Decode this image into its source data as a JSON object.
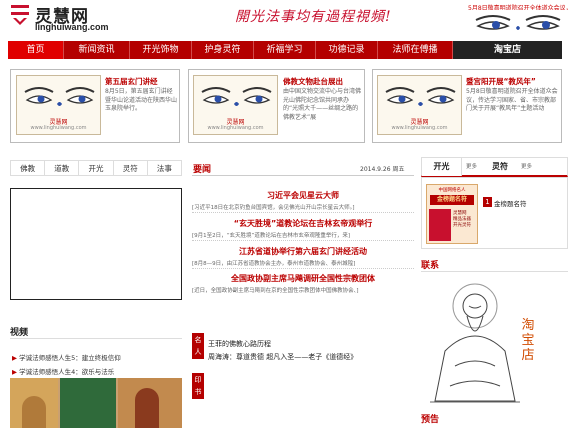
{
  "header": {
    "logo_cn": "灵慧网",
    "logo_en": "linghuiwang.com",
    "slogan": "開光法事均有過程視頻!",
    "banner_note": "5月8日敬喜明道院召开全体道众会议，传达学习国家、省、市宗教部门关于开展“教风年”"
  },
  "nav": [
    "首页",
    "新闻资讯",
    "开光饰物",
    "护身灵符",
    "祈福学习",
    "功德记录",
    "法师在傅播",
    "淘宝店"
  ],
  "promos": [
    {
      "title": "第五届玄门讲经",
      "desc": "8月5日，第五届玄门讲经暨华山论道活动在陕西华山玉泉院举行。",
      "img_caption": "灵慧网",
      "img_url": "www.linghuiwang.com"
    },
    {
      "title": "佛教文物赴台展出",
      "desc": "由中国文物交流中心与台湾佛光山佛陀纪念馆共同承办的“光照大千——丝绸之路的佛教艺术”展",
      "img_caption": "灵慧网",
      "img_url": "www.linghuiwang.com"
    },
    {
      "title": "暨宫阳开展“教风年”",
      "desc": "5月8日敬喜明道院召开全体道众会议，传达学习国家、省、市宗教部门关于开展“教风年”主题活动",
      "img_caption": "灵慧网",
      "img_url": "www.linghuiwang.com"
    }
  ],
  "left_tabs": [
    "佛教",
    "道教",
    "开光",
    "灵符",
    "法事"
  ],
  "video": {
    "title": "视频",
    "items": [
      "学诚法师感悟人生5：建立终极信仰",
      "学诚法师感悟人生4：欲乐与法乐"
    ]
  },
  "middle": {
    "section": "要闻",
    "date": "2014.9.26 周五",
    "news": [
      {
        "title": "习近平会见星云大师",
        "desc": "[习近平18日在北京钓鱼台国宾馆，会见佛光山开山宗长星云大师。]"
      },
      {
        "title": "“玄天胜境”道教论坛在吉林玄帝观举行",
        "desc": "[9月1至2日，“玄天胜境”道教论坛在吉林市玄帝观隆重举行，来]"
      },
      {
        "title": "江苏省道协举行第六届玄门讲经活动",
        "desc": "[8月8—9日，由江苏省道教协会主办，泰州市道教协会、泰州城隍]"
      },
      {
        "title": "全国政协副主席马飚调研全国性宗教团体",
        "desc": "[近日，全国政协副主席马飚到在京的全国性宗教团体中国佛教协会、]"
      }
    ],
    "tag1": "名人",
    "tag2": "印书",
    "famous_items": [
      "王菲的佛教心路历程",
      "周海涛：尊道贵德 超凡入圣——老子《道德经》"
    ]
  },
  "right": {
    "tab_active": "开光",
    "tab_other": "灵符",
    "more_label": "更多",
    "rank_no": "1",
    "rank_label": "金榜题名符",
    "card_top": "中国网络名人",
    "card_main": "金榜题名符",
    "card_side": [
      "灵慧网",
      "精品法器",
      "开光灵符"
    ],
    "contact_title": "联系",
    "shop_text": "淘宝店",
    "preview_title": "预告"
  },
  "colors": {
    "brand": "#b40000",
    "accent": "#e00000"
  }
}
